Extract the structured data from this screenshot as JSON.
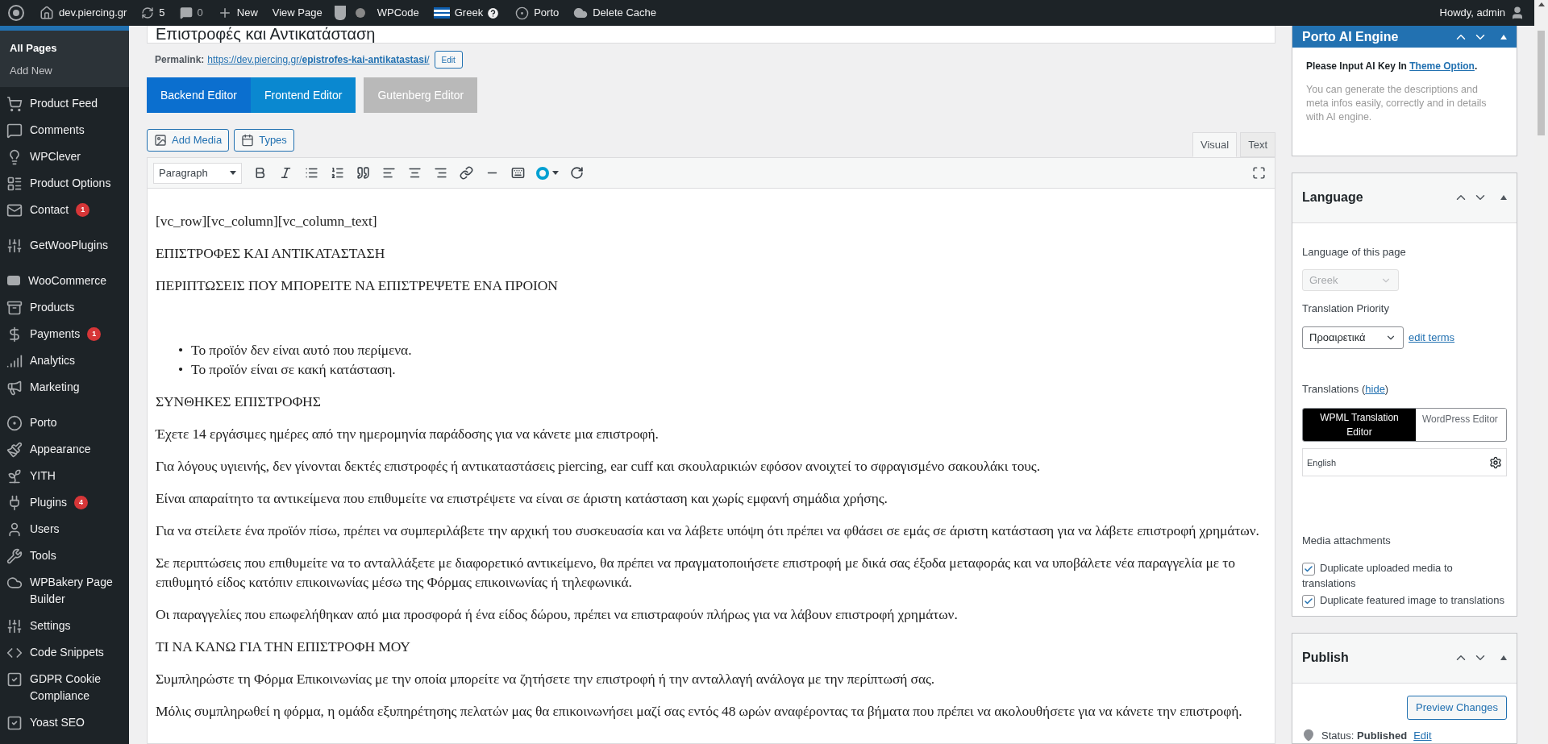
{
  "admin_bar": {
    "site": "dev.piercing.gr",
    "updates": "5",
    "comments": "0",
    "new": "New",
    "view_page": "View Page",
    "wpcode": "WPCode",
    "language": "Greek",
    "porto": "Porto",
    "delete_cache": "Delete Cache",
    "greeting": "Howdy, admin"
  },
  "sidebar": {
    "submenu": [
      {
        "label": "All Pages",
        "selected": true
      },
      {
        "label": "Add New",
        "selected": false
      }
    ],
    "groups": [
      [
        {
          "label": "Product Feed"
        },
        {
          "label": "Comments"
        },
        {
          "label": "WPClever"
        },
        {
          "label": "Product Options"
        },
        {
          "label": "Contact",
          "badge": "1"
        }
      ],
      [
        {
          "label": "GetWooPlugins"
        }
      ],
      [
        {
          "label": "WooCommerce"
        },
        {
          "label": "Products"
        },
        {
          "label": "Payments",
          "badge": "1"
        },
        {
          "label": "Analytics"
        },
        {
          "label": "Marketing"
        }
      ],
      [
        {
          "label": "Porto"
        },
        {
          "label": "Appearance"
        },
        {
          "label": "YITH"
        },
        {
          "label": "Plugins",
          "badge": "4"
        },
        {
          "label": "Users"
        },
        {
          "label": "Tools"
        },
        {
          "label": "WPBakery Page Builder"
        },
        {
          "label": "Settings"
        },
        {
          "label": "Code Snippets"
        },
        {
          "label": "GDPR Cookie Compliance"
        },
        {
          "label": "Yoast SEO"
        }
      ]
    ]
  },
  "editor": {
    "title": "Επιστροφές και Αντικατάσταση",
    "permalink_label": "Permalink:",
    "permalink": "https://dev.piercing.gr/**epistrofes-kai-antikatastasi**/",
    "permalink_edit": "Edit",
    "mode_buttons": [
      {
        "label": "Backend Editor",
        "kind": "bakery",
        "selected": true
      },
      {
        "label": "Frontend Editor",
        "kind": "bakery",
        "selected": false
      },
      {
        "label": "Gutenberg Editor",
        "kind": "gutenberg",
        "selected": false
      }
    ],
    "media_buttons": [
      "Add Media",
      "Types"
    ],
    "tabs": [
      {
        "label": "Visual",
        "selected": true
      },
      {
        "label": "Text",
        "selected": false
      }
    ],
    "format": "Paragraph",
    "content": [
      {
        "kind": "paragraph",
        "text": "[vc_row][vc_column][vc_column_text]"
      },
      {
        "kind": "paragraph",
        "text": "ΕΠΙΣΤΡΟΦΕΣ ΚΑΙ ΑΝΤΙΚΑΤΑΣΤΑΣΗ"
      },
      {
        "kind": "paragraph",
        "text": "ΠΕΡΙΠΤΩΣΕΙΣ ΠΟΥ ΜΠΟΡΕΙΤΕ ΝΑ ΕΠΙΣΤΡΕΨΕΤΕ ΕΝΑ ΠΡΟΙΟΝ"
      },
      {
        "kind": "list",
        "items": [
          {
            "marker": "•",
            "text": "Το προϊόν δεν είναι αυτό που περίμενα."
          },
          {
            "marker": "•",
            "text": "Το προϊόν είναι σε κακή κατάσταση."
          }
        ]
      },
      {
        "kind": "paragraph",
        "text": "ΣΥΝΘΗΚΕΣ ΕΠΙΣΤΡΟΦΗΣ"
      },
      {
        "kind": "paragraph",
        "text": "Έχετε 14 εργάσιμες ημέρες από την ημερομηνία παράδοσης για να κάνετε μια επιστροφή."
      },
      {
        "kind": "paragraph",
        "text": "Για λόγους υγιεινής, δεν γίνονται δεκτές επιστροφές ή αντικαταστάσεις piercing, ear cuff και σκουλαρικιών εφόσον ανοιχτεί το σφραγισμένο σακουλάκι τους."
      },
      {
        "kind": "paragraph",
        "text": "Είναι απαραίτητο τα αντικείμενα που επιθυμείτε να επιστρέψετε να είναι σε άριστη κατάσταση και χωρίς εμφανή σημάδια χρήσης."
      },
      {
        "kind": "paragraph",
        "text": "Για να στείλετε ένα προϊόν πίσω, πρέπει να συμπεριλάβετε την αρχική του συσκευασία και να λάβετε υπόψη ότι πρέπει να φθάσει σε εμάς σε άριστη κατάσταση για να λάβετε επιστροφή χρημάτων."
      },
      {
        "kind": "paragraph",
        "text": "Σε περιπτώσεις που επιθυμείτε να το ανταλλάξετε με διαφορετικό αντικείμενο, θα πρέπει να πραγματοποιήσετε επιστροφή με δικά σας έξοδα μεταφοράς και να υποβάλετε νέα παραγγελία με το επιθυμητό είδος κατόπιν επικοινωνίας μέσω της Φόρμας επικοινωνίας ή τηλεφωνικά."
      },
      {
        "kind": "paragraph",
        "text": "Οι παραγγελίες που επωφελήθηκαν από μια προσφορά ή ένα είδος δώρου, πρέπει να επιστραφούν πλήρως για να λάβουν επιστροφή χρημάτων."
      },
      {
        "kind": "paragraph",
        "text": "ΤΙ ΝΑ ΚΑΝΩ ΓΙΑ ΤΗΝ ΕΠΙΣΤΡΟΦΗ ΜΟΥ"
      },
      {
        "kind": "paragraph",
        "text": "Συμπληρώστε τη Φόρμα Επικοινωνίας με την οποία μπορείτε να ζητήσετε την επιστροφή ή την ανταλλαγή ανάλογα με την περίπτωσή σας."
      },
      {
        "kind": "paragraph",
        "text": "Μόλις συμπληρωθεί η φόρμα, η ομάδα εξυπηρέτησης πελατών μας θα επικοινωνήσει μαζί σας εντός 48 ωρών αναφέροντας τα βήματα που πρέπει να ακολουθήσετε για να κάνετε την επιστροφή."
      }
    ]
  },
  "ai_panel": {
    "title": "Porto AI Engine",
    "notice_before": "Please Input AI Key In ",
    "notice_link": "Theme Option",
    "notice_after": ".",
    "description": "You can generate the descriptions and meta infos easily, correctly and in details with AI engine."
  },
  "language_panel": {
    "title": "Language",
    "language_label": "Language of this page",
    "language_value": "Greek",
    "priority_label": "Translation Priority",
    "priority_value": "Προαιρετικά",
    "edit_terms": "edit terms",
    "translations_before": "Translations (",
    "hide_link": "hide",
    "translations_after": ")",
    "editor_options": [
      {
        "label": "WPML Translation Editor",
        "selected": true
      },
      {
        "label": "WordPress Editor",
        "selected": false
      }
    ],
    "translation_language": "English",
    "media_label": "Media attachments",
    "checkboxes": [
      {
        "label": "Duplicate uploaded media to translations",
        "checked": true
      },
      {
        "label": "Duplicate featured image to translations",
        "checked": true
      }
    ]
  },
  "publish_panel": {
    "title": "Publish",
    "preview_button": "Preview Changes",
    "status": "Status: **Published**",
    "status_edit": "Edit"
  }
}
